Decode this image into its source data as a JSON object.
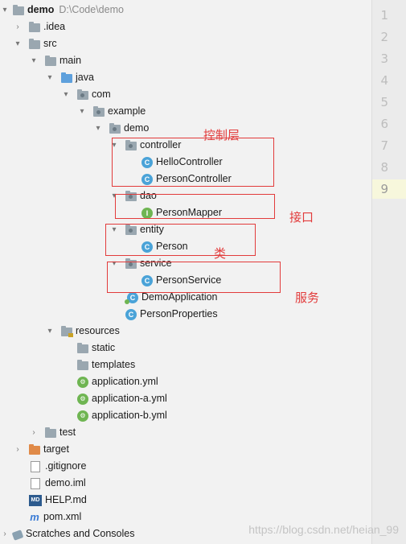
{
  "tree": {
    "project_name": "demo",
    "project_path": "D:\\Code\\demo",
    "nodes": {
      "idea": ".idea",
      "src": "src",
      "main": "main",
      "java": "java",
      "com": "com",
      "example": "example",
      "demo_pkg": "demo",
      "controller": "controller",
      "hello_controller": "HelloController",
      "person_controller": "PersonController",
      "dao": "dao",
      "person_mapper": "PersonMapper",
      "entity": "entity",
      "person": "Person",
      "service": "service",
      "person_service": "PersonService",
      "demo_application": "DemoApplication",
      "person_properties": "PersonProperties",
      "resources": "resources",
      "static": "static",
      "templates": "templates",
      "application_yml": "application.yml",
      "application_a_yml": "application-a.yml",
      "application_b_yml": "application-b.yml",
      "test": "test",
      "target": "target",
      "gitignore": ".gitignore",
      "demo_iml": "demo.iml",
      "help_md": "HELP.md",
      "pom_xml": "pom.xml",
      "scratches": "Scratches and Consoles"
    }
  },
  "annotations": {
    "controller_layer": "控制层",
    "interface": "接口",
    "class": "类",
    "service": "服务"
  },
  "gutter": {
    "line_numbers": [
      "1",
      "2",
      "3",
      "4",
      "5",
      "6",
      "7",
      "8",
      "9"
    ]
  },
  "watermark": "https://blog.csdn.net/heian_99",
  "colors": {
    "annotation": "#e23b3b",
    "class_icon": "#4aa3d8",
    "interface_icon": "#6fb552"
  }
}
